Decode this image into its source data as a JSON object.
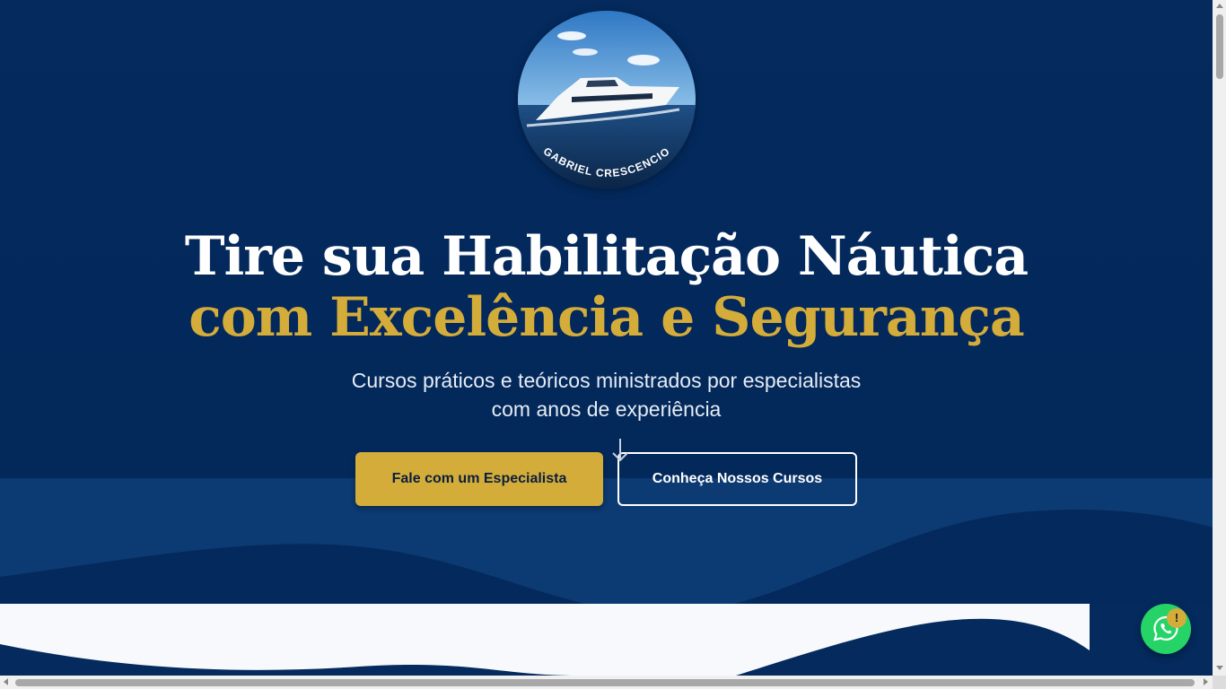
{
  "brand": {
    "logo_text": "GABRIEL CRESCENCIO",
    "logo_alt": "boat-logo"
  },
  "hero": {
    "title_line1": "Tire sua Habilitação Náutica",
    "title_line2": "com Excelência e Segurança",
    "subtitle_line1": "Cursos práticos e teóricos ministrados por especialistas",
    "subtitle_line2": "com anos de experiência",
    "primary_button": "Fale com um Especialista",
    "secondary_button": "Conheça Nossos Cursos"
  },
  "whatsapp": {
    "badge": "!"
  },
  "colors": {
    "navy": "#042a5e",
    "gold": "#d4ac3a",
    "whatsapp_green": "#25d366"
  },
  "icons": [
    "boat-logo",
    "scroll-down-arrow-icon",
    "whatsapp-icon"
  ]
}
